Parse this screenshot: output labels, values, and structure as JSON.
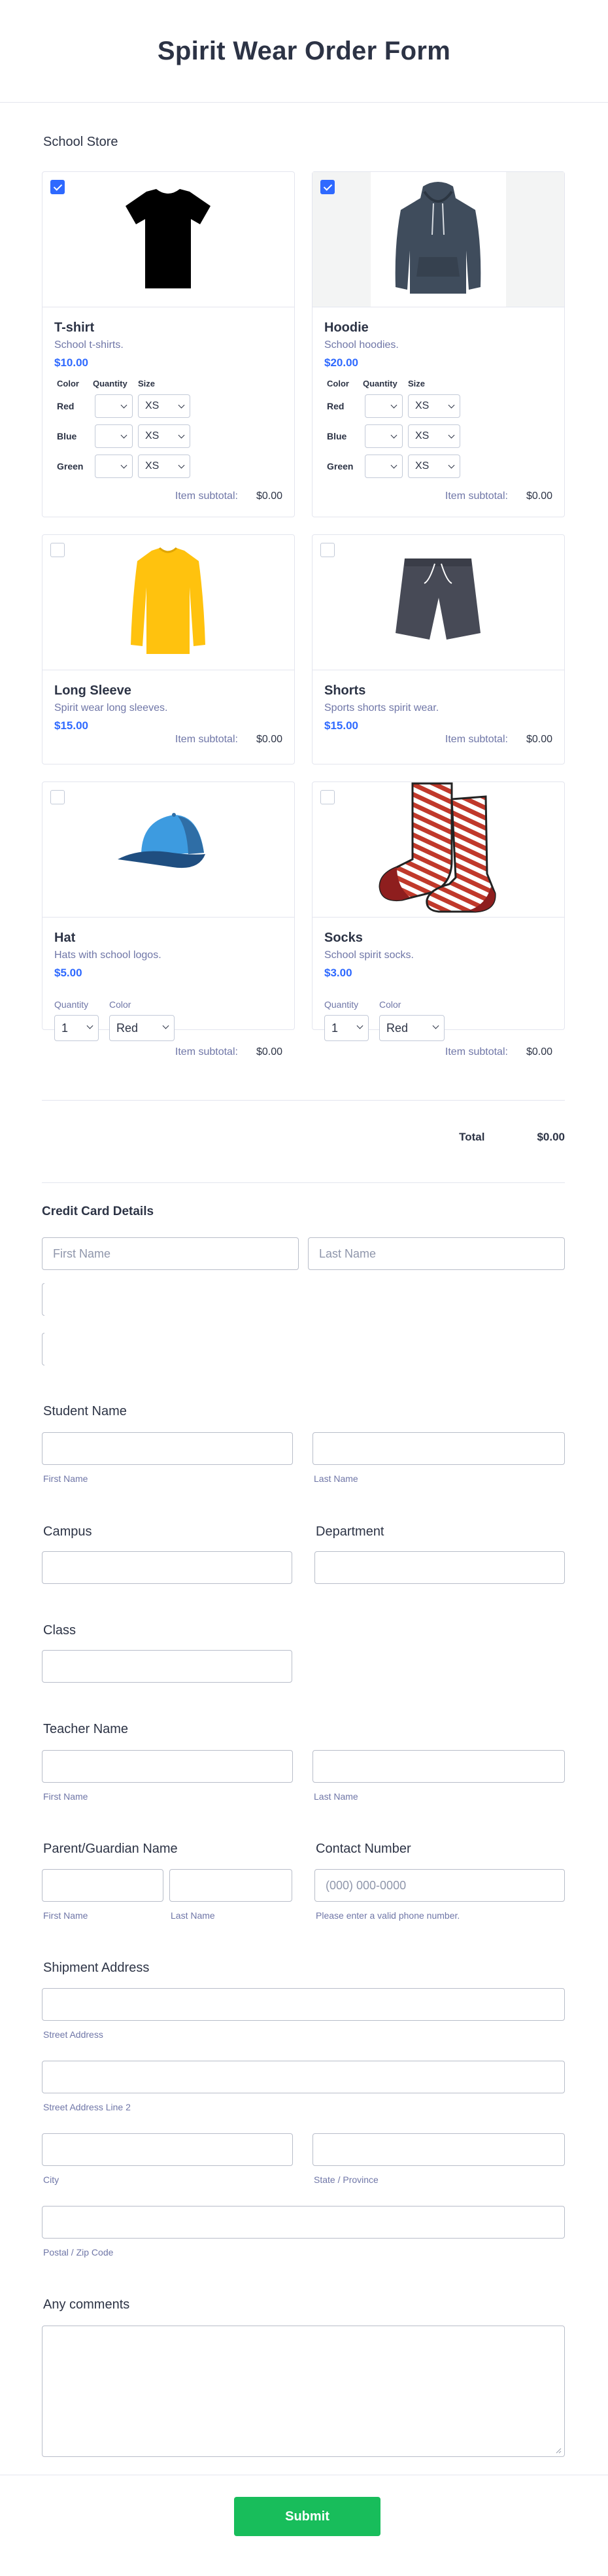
{
  "form_title": "Spirit Wear Order Form",
  "store": {
    "section_label": "School Store",
    "products": [
      {
        "name": "T-shirt",
        "description": "School t-shirts.",
        "price": "$10.00",
        "checked": true,
        "image": "tshirt-icon",
        "options_header": [
          "Color",
          "Quantity",
          "Size"
        ],
        "rows": [
          {
            "color": "Red",
            "size": "XS"
          },
          {
            "color": "Blue",
            "size": "XS"
          },
          {
            "color": "Green",
            "size": "XS"
          }
        ],
        "subtotal_label": "Item subtotal:",
        "subtotal": "$0.00"
      },
      {
        "name": "Hoodie",
        "description": "School hoodies.",
        "price": "$20.00",
        "checked": true,
        "image": "hoodie-icon",
        "options_header": [
          "Color",
          "Quantity",
          "Size"
        ],
        "rows": [
          {
            "color": "Red",
            "size": "XS"
          },
          {
            "color": "Blue",
            "size": "XS"
          },
          {
            "color": "Green",
            "size": "XS"
          }
        ],
        "subtotal_label": "Item subtotal:",
        "subtotal": "$0.00"
      },
      {
        "name": "Long Sleeve",
        "description": "Spirit wear long sleeves.",
        "price": "$15.00",
        "checked": false,
        "image": "long-sleeve-icon",
        "subtotal_label": "Item subtotal:",
        "subtotal": "$0.00"
      },
      {
        "name": "Shorts",
        "description": "Sports shorts spirit wear.",
        "price": "$15.00",
        "checked": false,
        "image": "shorts-icon",
        "subtotal_label": "Item subtotal:",
        "subtotal": "$0.00"
      },
      {
        "name": "Hat",
        "description": "Hats with school logos.",
        "price": "$5.00",
        "checked": false,
        "image": "cap-icon",
        "quantity_label": "Quantity",
        "quantity_value": "1",
        "color_label": "Color",
        "color_value": "Red",
        "subtotal_label": "Item subtotal:",
        "subtotal": "$0.00"
      },
      {
        "name": "Socks",
        "description": "School spirit socks.",
        "price": "$3.00",
        "checked": false,
        "image": "socks-icon",
        "quantity_label": "Quantity",
        "quantity_value": "1",
        "color_label": "Color",
        "color_value": "Red",
        "subtotal_label": "Item subtotal:",
        "subtotal": "$0.00"
      }
    ],
    "total_label": "Total",
    "total_value": "$0.00"
  },
  "credit_card": {
    "label": "Credit Card Details",
    "first_name_placeholder": "First Name",
    "last_name_placeholder": "Last Name"
  },
  "student_name": {
    "label": "Student Name",
    "first_sub": "First Name",
    "last_sub": "Last Name"
  },
  "campus": {
    "label": "Campus"
  },
  "department": {
    "label": "Department"
  },
  "class": {
    "label": "Class"
  },
  "teacher_name": {
    "label": "Teacher Name",
    "first_sub": "First Name",
    "last_sub": "Last Name"
  },
  "parent_name": {
    "label": "Parent/Guardian Name",
    "first_sub": "First Name",
    "last_sub": "Last Name"
  },
  "contact": {
    "label": "Contact Number",
    "placeholder": "(000) 000-0000",
    "sub": "Please enter a valid phone number."
  },
  "address": {
    "label": "Shipment Address",
    "street_sub": "Street Address",
    "street2_sub": "Street Address Line 2",
    "city_sub": "City",
    "state_sub": "State / Province",
    "zip_sub": "Postal / Zip Code"
  },
  "comments": {
    "label": "Any comments"
  },
  "submit_label": "Submit",
  "colors": {
    "accent": "#2e69ff",
    "submit": "#18bd5b",
    "border": "#b8bdc9"
  }
}
